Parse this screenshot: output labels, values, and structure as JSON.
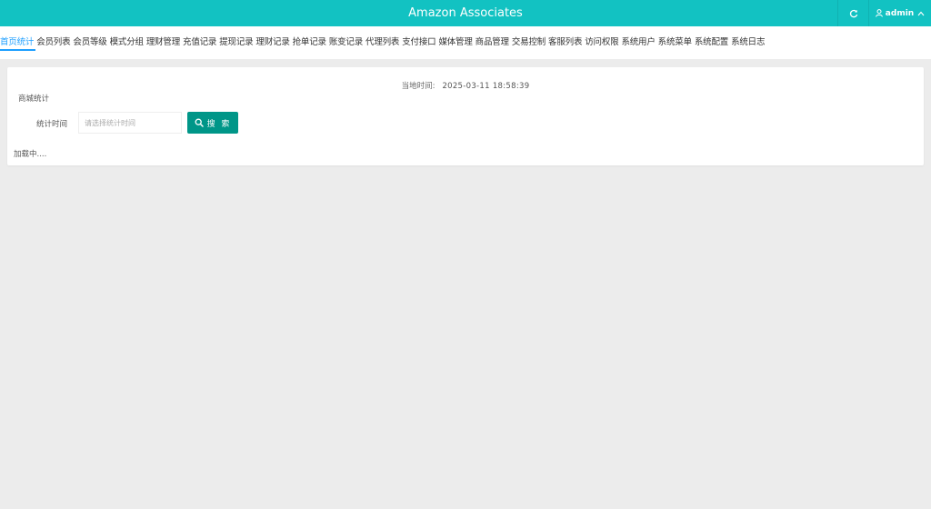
{
  "header": {
    "title": "Amazon Associates",
    "refresh_icon": "refresh-icon",
    "user_icon": "user-icon",
    "username": "admin",
    "caret_icon": "chevron-up-icon"
  },
  "nav": {
    "items": [
      {
        "label": "首页统计",
        "active": true
      },
      {
        "label": "会员列表"
      },
      {
        "label": "会员等级"
      },
      {
        "label": "模式分组"
      },
      {
        "label": "理财管理"
      },
      {
        "label": "充值记录"
      },
      {
        "label": "提现记录"
      },
      {
        "label": "理财记录"
      },
      {
        "label": "抢单记录"
      },
      {
        "label": "账变记录"
      },
      {
        "label": "代理列表"
      },
      {
        "label": "支付接口"
      },
      {
        "label": "媒体管理"
      },
      {
        "label": "商品管理"
      },
      {
        "label": "交易控制"
      },
      {
        "label": "客服列表"
      },
      {
        "label": "访问权限"
      },
      {
        "label": "系统用户"
      },
      {
        "label": "系统菜单"
      },
      {
        "label": "系统配置"
      },
      {
        "label": "系统日志"
      }
    ]
  },
  "stats": {
    "current_time_label": "当地时间:",
    "current_time_value": "2025-03-11 18:58:39",
    "section_title": "商城统计",
    "time_field_label": "统计时间",
    "time_field_placeholder": "请选择统计时间",
    "time_field_value": "",
    "search_label": "搜 索",
    "search_icon": "search-icon",
    "loading_text": "加载中...."
  },
  "colors": {
    "header_bg": "#12c2c2",
    "active_tab": "#1e9fff",
    "search_button": "#009688",
    "page_bg": "#ececec"
  }
}
